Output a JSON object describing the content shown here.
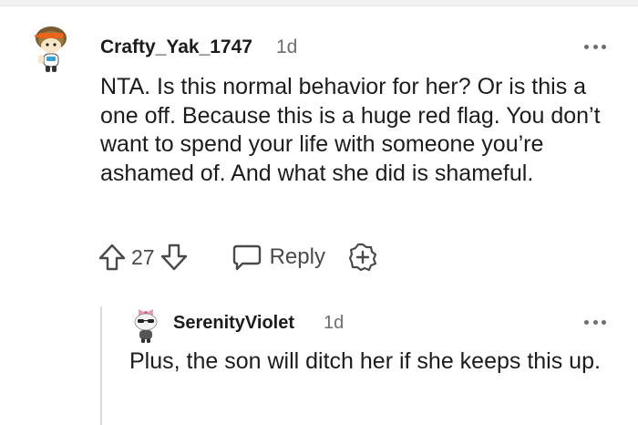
{
  "comment": {
    "username": "Crafty_Yak_1747",
    "time": "1d",
    "body": "NTA. Is this normal behavior for her? Or is this a one off. Because this is a huge red flag. You don’t want to spend your life with someone you’re ashamed of. And what she did is shameful.",
    "score": "27",
    "reply_label": "Reply",
    "icons": {
      "upvote": "upvote-arrow-icon",
      "downvote": "downvote-arrow-icon",
      "reply": "speech-bubble-icon",
      "award": "award-plus-icon",
      "more": "more-dots-icon"
    }
  },
  "reply": {
    "username": "SerenityViolet",
    "time": "1d",
    "body": "Plus, the son will ditch her if she keeps this up."
  },
  "colors": {
    "text": "#1c1c1c",
    "muted": "#6e6e6e",
    "icon": "#4a4a4a",
    "thread_line": "#dcdcdc"
  }
}
